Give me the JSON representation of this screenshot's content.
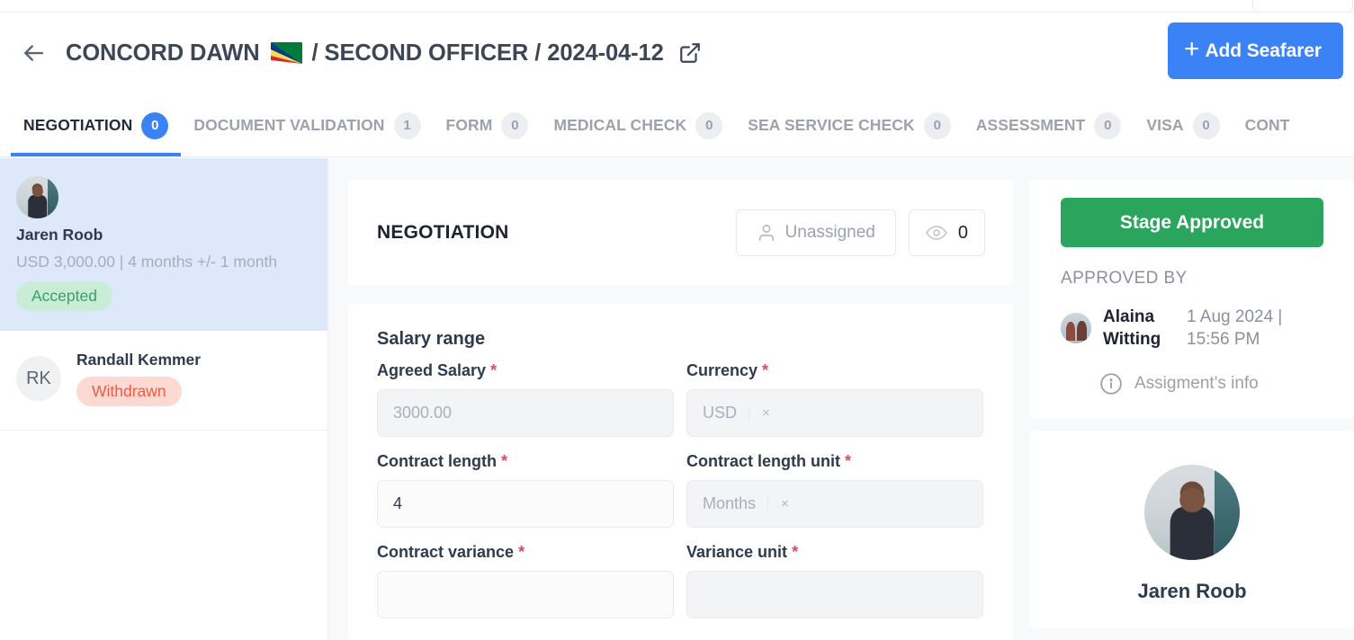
{
  "header": {
    "back_icon": "arrow-left-icon",
    "vessel": "CONCORD DAWN",
    "flag": "seychelles-flag",
    "sep1": "/",
    "rank": "SECOND OFFICER",
    "sep2": "/",
    "date": "2024-04-12",
    "external_link_icon": "external-link-icon",
    "add_button": "Add Seafarer",
    "add_button_icon": "plus-icon",
    "accent_blue": "#3b82f6"
  },
  "tabs": [
    {
      "label": "NEGOTIATION",
      "count": "0",
      "active": true
    },
    {
      "label": "DOCUMENT VALIDATION",
      "count": "1",
      "active": false
    },
    {
      "label": "FORM",
      "count": "0",
      "active": false
    },
    {
      "label": "MEDICAL CHECK",
      "count": "0",
      "active": false
    },
    {
      "label": "SEA SERVICE CHECK",
      "count": "0",
      "active": false
    },
    {
      "label": "ASSESSMENT",
      "count": "0",
      "active": false
    },
    {
      "label": "VISA",
      "count": "0",
      "active": false
    },
    {
      "label": "CONT",
      "count": "",
      "active": false
    }
  ],
  "sidebar": {
    "candidates": [
      {
        "name": "Jaren Roob",
        "meta": "USD 3,000.00  |  4 months +/- 1 month",
        "status": "Accepted",
        "status_color": "#3d9e63",
        "selected": true
      },
      {
        "name": "Randall Kemmer",
        "initials": "RK",
        "status": "Withdrawn",
        "status_color": "#ea5c48",
        "selected": false
      }
    ]
  },
  "stage": {
    "title": "NEGOTIATION",
    "assignee": "Unassigned",
    "assignee_icon": "user-icon",
    "views_icon": "eye-icon",
    "views_count": "0"
  },
  "form": {
    "section_title": "Salary range",
    "required_mark": "*",
    "fields": [
      {
        "label": "Agreed Salary",
        "value": "3000.00",
        "filled": false,
        "type": "text"
      },
      {
        "label": "Currency",
        "value": "USD",
        "filled": false,
        "type": "select",
        "remove": "×"
      },
      {
        "label": "Contract length",
        "value": "4",
        "filled": true,
        "type": "text"
      },
      {
        "label": "Contract length unit",
        "value": "Months",
        "filled": false,
        "type": "select",
        "remove": "×"
      },
      {
        "label": "Contract variance",
        "value": "",
        "filled": true,
        "type": "text"
      },
      {
        "label": "Variance unit",
        "value": "",
        "filled": false,
        "type": "select",
        "remove": ""
      }
    ]
  },
  "approval": {
    "button": "Stage Approved",
    "button_color": "#2ba55d",
    "heading": "APPROVED BY",
    "approver_name": "Alaina Witting",
    "approver_date": "1 Aug 2024 | 15:56 PM",
    "info_icon": "info-icon",
    "info_label": "Assigment's info"
  },
  "profile": {
    "name": "Jaren Roob",
    "avatar": "seafarer-photo"
  }
}
